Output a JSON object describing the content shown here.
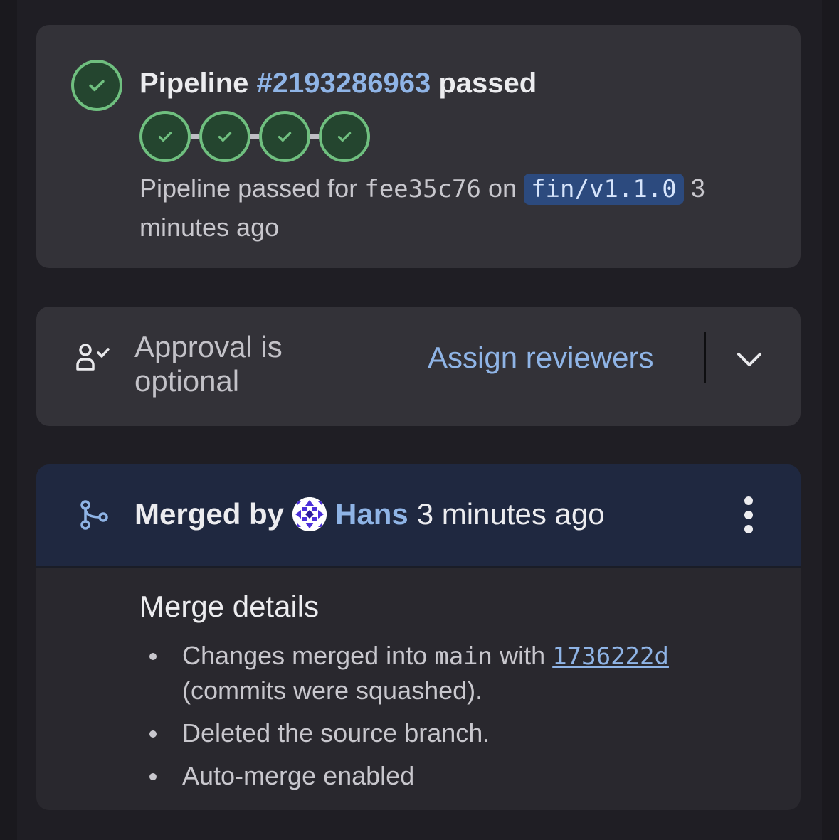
{
  "pipeline": {
    "title_prefix": "Pipeline",
    "pipeline_id": "#2193286963",
    "title_suffix": "passed",
    "stages_count": 4,
    "desc_prefix": "Pipeline passed for",
    "commit_sha": "fee35c76",
    "desc_on": "on",
    "branch": "fin/v1.1.0",
    "desc_time": "3 minutes ago",
    "status_color": "#6fbf7f"
  },
  "approval": {
    "text": "Approval is optional",
    "assign_label": "Assign reviewers",
    "icon": "approval-user-check-icon"
  },
  "merged": {
    "label": "Merged by",
    "user": "Hans",
    "time": "3 minutes ago",
    "details_title": "Merge details",
    "detail1_prefix": "Changes merged into",
    "target_branch": "main",
    "detail1_with": "with",
    "merge_commit": "1736222d",
    "detail1_suffix": "(commits were squashed).",
    "detail2": "Deleted the source branch.",
    "detail3": "Auto-merge enabled"
  },
  "colors": {
    "accent_link": "#8fb4e6",
    "success": "#6fbf7f",
    "merged_header_bg": "#1f2840"
  }
}
